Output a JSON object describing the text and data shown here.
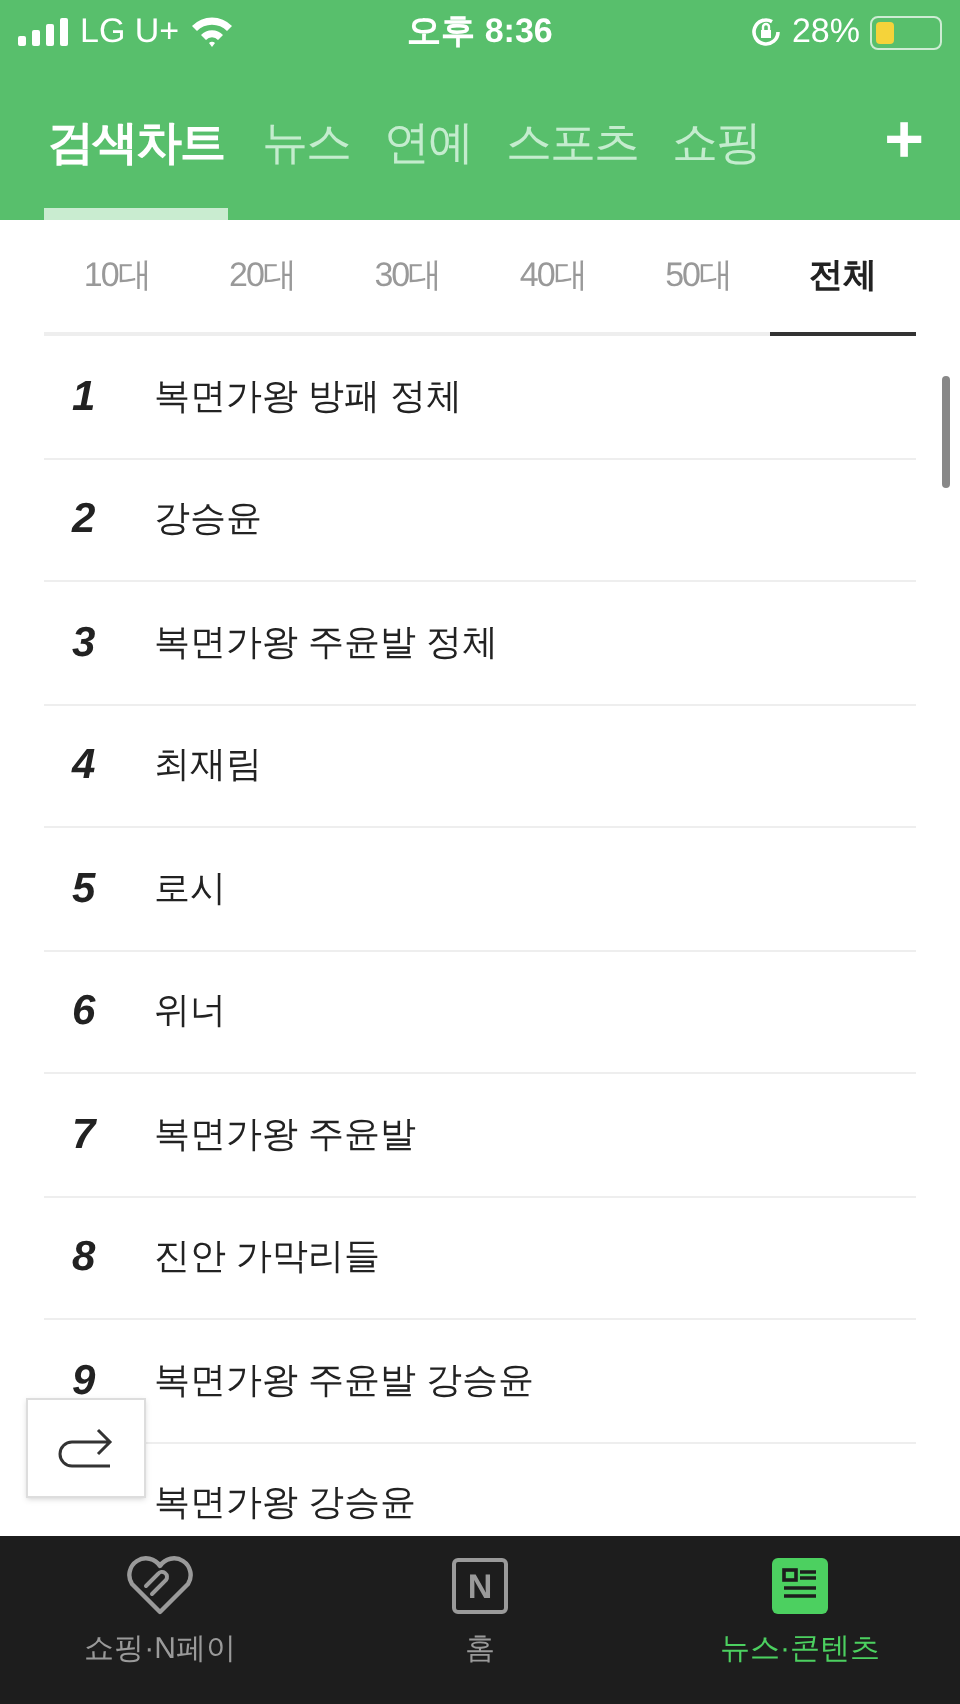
{
  "status_bar": {
    "carrier": "LG U+",
    "time": "오후 8:36",
    "battery": "28%"
  },
  "tabs": [
    {
      "label": "검색차트",
      "selected": true
    },
    {
      "label": "뉴스",
      "selected": false
    },
    {
      "label": "연예",
      "selected": false
    },
    {
      "label": "스포츠",
      "selected": false
    },
    {
      "label": "쇼핑",
      "selected": false
    }
  ],
  "add_button": "+",
  "age_tabs": [
    {
      "label": "10대",
      "selected": false
    },
    {
      "label": "20대",
      "selected": false
    },
    {
      "label": "30대",
      "selected": false
    },
    {
      "label": "40대",
      "selected": false
    },
    {
      "label": "50대",
      "selected": false
    },
    {
      "label": "전체",
      "selected": true
    }
  ],
  "ranking": [
    {
      "rank": "1",
      "keyword": "복면가왕 방패 정체"
    },
    {
      "rank": "2",
      "keyword": "강승윤"
    },
    {
      "rank": "3",
      "keyword": "복면가왕 주윤발 정체"
    },
    {
      "rank": "4",
      "keyword": "최재림"
    },
    {
      "rank": "5",
      "keyword": "로시"
    },
    {
      "rank": "6",
      "keyword": "위너"
    },
    {
      "rank": "7",
      "keyword": "복면가왕 주윤발"
    },
    {
      "rank": "8",
      "keyword": "진안 가막리들"
    },
    {
      "rank": "9",
      "keyword": "복면가왕 주윤발 강승윤"
    },
    {
      "keyword": "복면가왕 강승윤"
    }
  ],
  "bottom_nav": [
    {
      "kind": "heart",
      "label": "쇼핑·N페이",
      "selected": false
    },
    {
      "kind": "letter",
      "icon_text": "N",
      "label": "홈",
      "selected": false
    },
    {
      "kind": "news",
      "label": "뉴스·콘텐츠",
      "selected": true
    }
  ]
}
